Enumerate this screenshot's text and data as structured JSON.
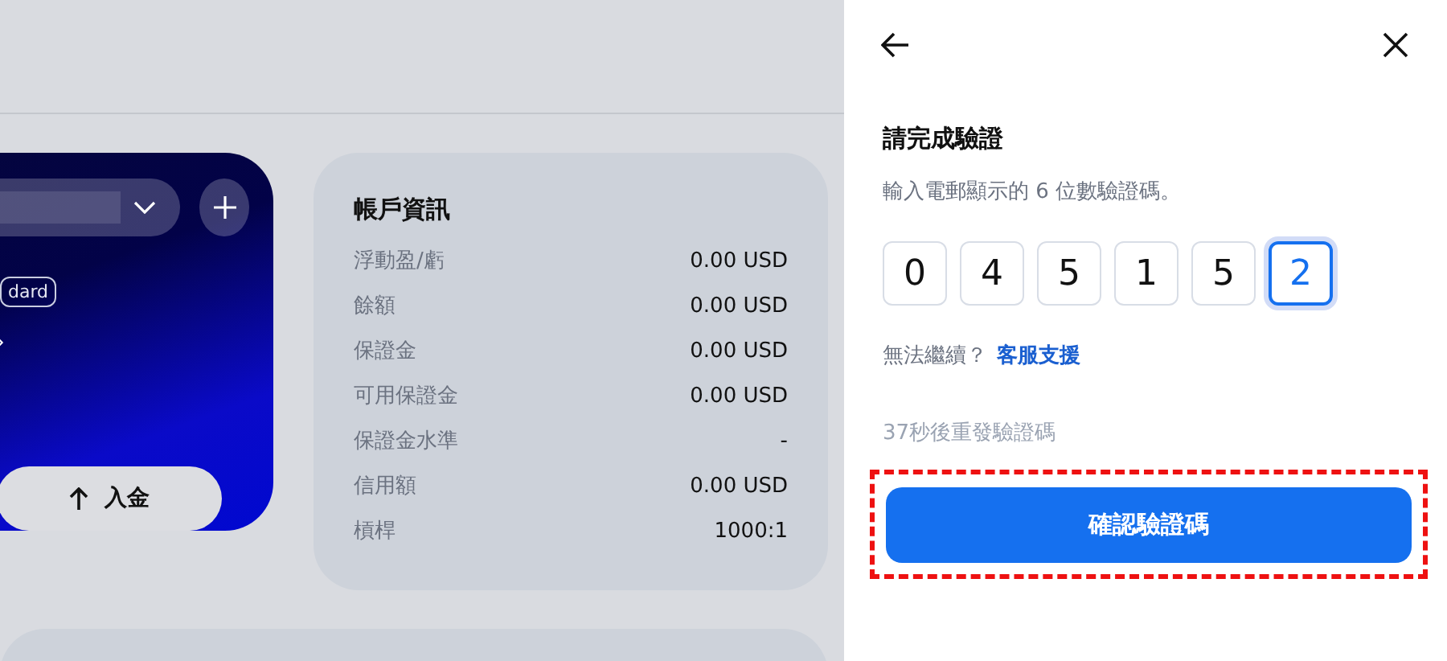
{
  "account_card": {
    "badge": "dard",
    "deposit_button": "入金"
  },
  "account_info": {
    "title": "帳戶資訊",
    "rows": [
      {
        "label": "浮動盈/虧",
        "value": "0.00 USD"
      },
      {
        "label": "餘額",
        "value": "0.00 USD"
      },
      {
        "label": "保證金",
        "value": "0.00 USD"
      },
      {
        "label": "可用保證金",
        "value": "0.00 USD"
      },
      {
        "label": "保證金水準",
        "value": "-"
      },
      {
        "label": "信用額",
        "value": "0.00 USD"
      },
      {
        "label": "槓桿",
        "value": "1000:1"
      }
    ]
  },
  "verify_panel": {
    "title": "請完成驗證",
    "subtitle": "輸入電郵顯示的 6 位數驗證碼。",
    "digits": [
      {
        "value": "0",
        "selected": false
      },
      {
        "value": "4",
        "selected": false
      },
      {
        "value": "5",
        "selected": false
      },
      {
        "value": "1",
        "selected": false
      },
      {
        "value": "5",
        "selected": false
      },
      {
        "value": "2",
        "selected": true
      }
    ],
    "help_text": "無法繼續？",
    "help_link": "客服支援",
    "resend_text": "37秒後重發驗證碼",
    "confirm_button": {
      "label": "確認驗證碼",
      "highlighted": true
    }
  }
}
